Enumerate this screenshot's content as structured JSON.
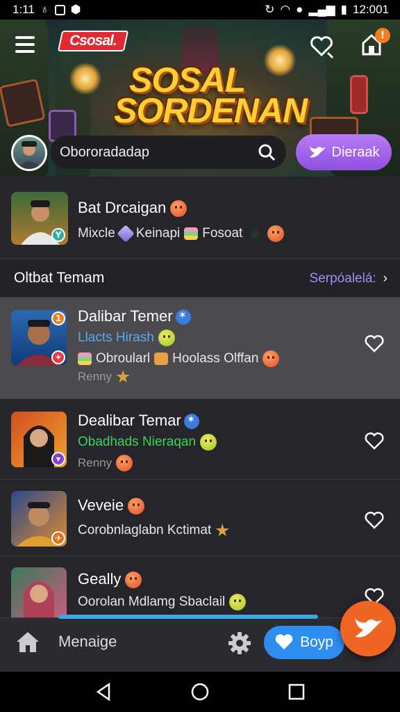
{
  "status_bar": {
    "time": "1:11",
    "right_time": "12:001"
  },
  "hero": {
    "logo": "Csosal.",
    "title_line1": "SOSAL",
    "title_line2": "SORDENAN",
    "notification_count": "!",
    "search_placeholder": "Obororadadap",
    "action_button": "Dieraak"
  },
  "featured": {
    "name": "Bat Drcaigan",
    "sub_items": [
      "Mixcle",
      "Keinapi",
      "Fosoat"
    ]
  },
  "section": {
    "title": "Oltbat Temam",
    "link": "Serpóalelá:"
  },
  "rows": [
    {
      "name": "Dalibar Temer",
      "subtitle": "Llacts Hirash",
      "tags": [
        "Obroularl",
        "Hoolass Olffan"
      ],
      "meta": "Renny",
      "badge": "1"
    },
    {
      "name": "Dealibar Temar",
      "subtitle": "Obadhads Nieraqan",
      "meta": "Renny"
    },
    {
      "name": "Veveie",
      "subtitle": "Corobnlaglabn Kctimat"
    },
    {
      "name": "Geally",
      "subtitle": "Oorolan Mdlamg Sbaclail"
    }
  ],
  "bottom": {
    "manage_label": "Menaige",
    "cta_label": "Boyp"
  },
  "colors": {
    "accent_purple": "#9a5ff0",
    "accent_orange": "#f06424",
    "accent_blue": "#2d8df0",
    "subtitle_blue": "#5aa8f0",
    "subtitle_green": "#3ed35a"
  }
}
